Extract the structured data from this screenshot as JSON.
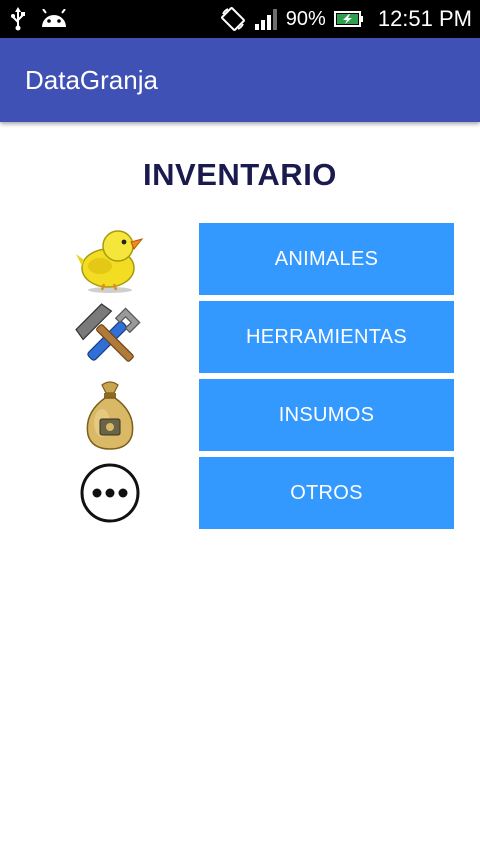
{
  "status_bar": {
    "battery_percent": "90%",
    "time": "12:51 PM",
    "icons": [
      "usb-icon",
      "android-icon",
      "screen-rotation-icon",
      "signal-icon",
      "battery-charging-icon"
    ]
  },
  "app_bar": {
    "title": "DataGranja",
    "color": "#3f51b5"
  },
  "inventory": {
    "title": "INVENTARIO",
    "button_color": "#3399ff",
    "items": [
      {
        "label": "ANIMALES",
        "icon": "chick-icon"
      },
      {
        "label": "HERRAMIENTAS",
        "icon": "tools-icon"
      },
      {
        "label": "INSUMOS",
        "icon": "money-bag-icon"
      },
      {
        "label": "OTROS",
        "icon": "more-icon"
      }
    ]
  }
}
